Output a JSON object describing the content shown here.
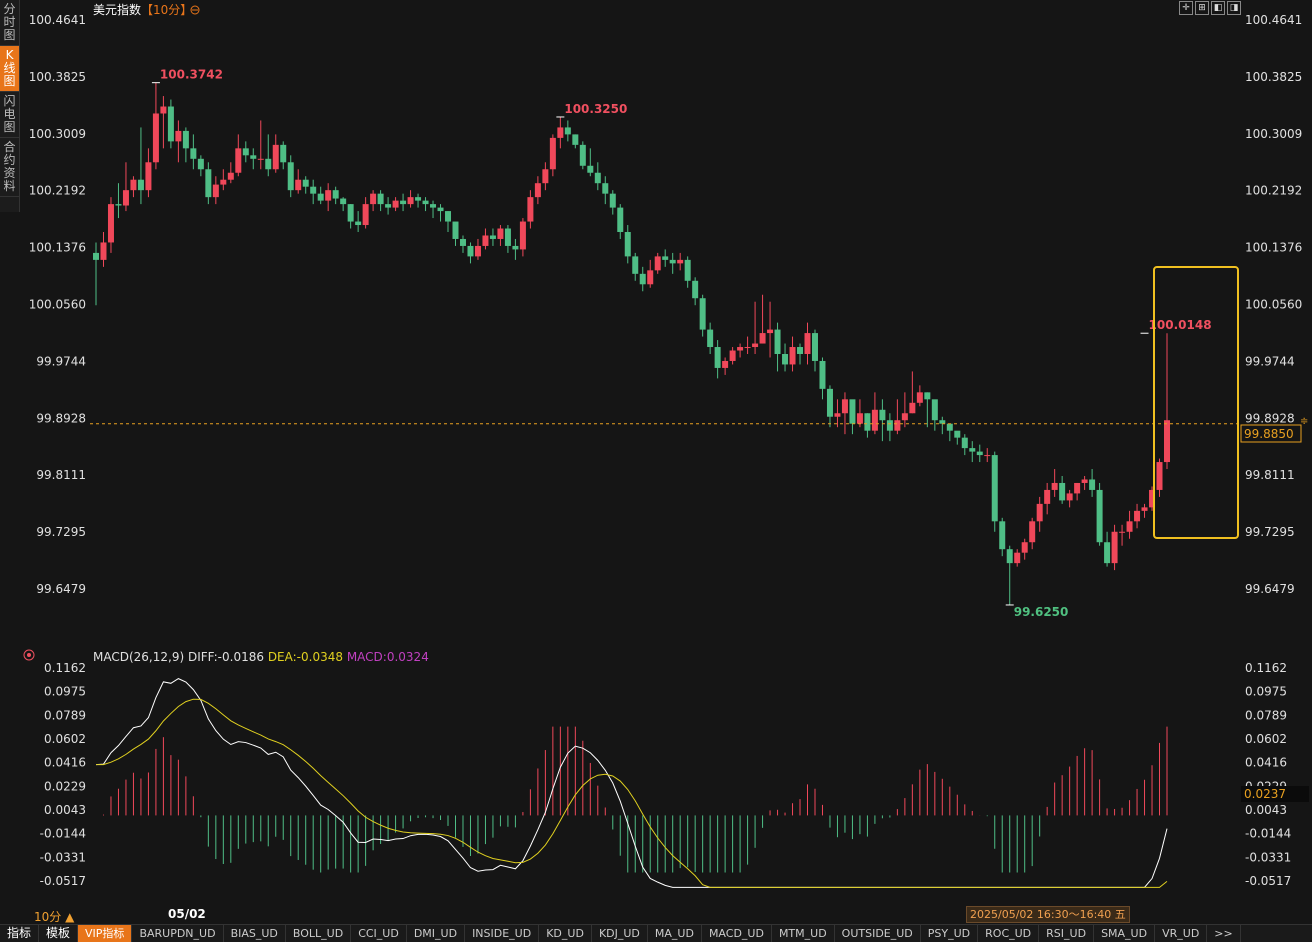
{
  "side_tabs": [
    {
      "label": "分时图",
      "active": false
    },
    {
      "label": "K线图",
      "active": true
    },
    {
      "label": "闪电图",
      "active": false
    },
    {
      "label": "合约资料",
      "active": false
    }
  ],
  "header": {
    "title": "美元指数",
    "period": "【10分】",
    "period_icon": "settings-circle-icon"
  },
  "top_icons": [
    "crosshair-icon",
    "maximize-icon",
    "left-icon",
    "right-icon"
  ],
  "price_axis": {
    "labels": [
      "100.4641",
      "100.3825",
      "100.3009",
      "100.2192",
      "100.1376",
      "100.0560",
      "99.9744",
      "99.8928",
      "99.8111",
      "99.7295",
      "99.6479"
    ],
    "min": 99.6479,
    "max": 100.4641
  },
  "current_price": {
    "value": 99.885,
    "label": "99.8850"
  },
  "annotations": [
    {
      "text": "100.3742",
      "value": 100.3742,
      "candle": 8,
      "color": "#f05060"
    },
    {
      "text": "100.3250",
      "value": 100.325,
      "candle": 62,
      "color": "#f05060"
    },
    {
      "text": "100.0148",
      "value": 100.0148,
      "candle": 140,
      "color": "#f05060"
    },
    {
      "text": "99.6250",
      "value": 99.625,
      "candle": 122,
      "color": "#50c080"
    }
  ],
  "macd": {
    "title": "MACD(26,12,9)",
    "diff": "DIFF:-0.0186",
    "dea": "DEA:-0.0348",
    "macd": "MACD:0.0324",
    "axis_labels": [
      "0.1162",
      "0.0975",
      "0.0789",
      "0.0602",
      "0.0416",
      "0.0229",
      "0.0043",
      "-0.0144",
      "-0.0331",
      "-0.0517"
    ],
    "min": -0.0517,
    "max": 0.1162,
    "current_label": "0.0237"
  },
  "period_label": "10分 ▲",
  "date_label": "05/02",
  "time_range": "2025/05/02 16:30～16:40 五",
  "bottom_tabs": [
    "指标",
    "模板",
    "VIP指标",
    "BARUPDN_UD",
    "BIAS_UD",
    "BOLL_UD",
    "CCI_UD",
    "DMI_UD",
    "INSIDE_UD",
    "KD_UD",
    "KDJ_UD",
    "MA_UD",
    "MACD_UD",
    "MTM_UD",
    "OUTSIDE_UD",
    "PSY_UD",
    "ROC_UD",
    "RSI_UD",
    "SMA_UD",
    "VR_UD",
    ">>"
  ],
  "colors": {
    "up": "#f0485a",
    "down": "#4fbe86",
    "diff": "#ffffff",
    "dea": "#e0d020",
    "highlight": "#f0c020"
  },
  "chart_data": {
    "type": "candlestick",
    "close": [
      100.12,
      100.145,
      100.2,
      100.198,
      100.22,
      100.235,
      100.22,
      100.26,
      100.33,
      100.34,
      100.29,
      100.305,
      100.28,
      100.265,
      100.25,
      100.21,
      100.228,
      100.235,
      100.245,
      100.28,
      100.27,
      100.265,
      100.265,
      100.25,
      100.285,
      100.26,
      100.22,
      100.235,
      100.225,
      100.215,
      100.205,
      100.22,
      100.208,
      100.2,
      100.175,
      100.17,
      100.2,
      100.215,
      100.2,
      100.195,
      100.205,
      100.2,
      100.21,
      100.205,
      100.2,
      100.195,
      100.19,
      100.175,
      100.15,
      100.14,
      100.125,
      100.14,
      100.155,
      100.15,
      100.165,
      100.14,
      100.135,
      100.175,
      100.21,
      100.23,
      100.25,
      100.295,
      100.31,
      100.3,
      100.285,
      100.255,
      100.245,
      100.23,
      100.215,
      100.195,
      100.16,
      100.125,
      100.1,
      100.085,
      100.105,
      100.125,
      100.12,
      100.115,
      100.12,
      100.09,
      100.065,
      100.02,
      99.995,
      99.965,
      99.975,
      99.99,
      99.995,
      99.995,
      100.0,
      100.015,
      100.02,
      99.985,
      99.97,
      99.995,
      99.985,
      100.015,
      99.975,
      99.935,
      99.895,
      99.9,
      99.92,
      99.885,
      99.9,
      99.875,
      99.905,
      99.89,
      99.875,
      99.89,
      99.9,
      99.915,
      99.93,
      99.92,
      99.89,
      99.885,
      99.875,
      99.865,
      99.85,
      99.845,
      99.84,
      99.84,
      99.745,
      99.705,
      99.685,
      99.7,
      99.715,
      99.745,
      99.77,
      99.79,
      99.8,
      99.775,
      99.785,
      99.8,
      99.805,
      99.79,
      99.715,
      99.685,
      99.73,
      99.73,
      99.745,
      99.76,
      99.765,
      99.79,
      99.83,
      99.89
    ],
    "open": [
      100.13,
      100.12,
      100.145,
      100.2,
      100.198,
      100.22,
      100.235,
      100.22,
      100.26,
      100.33,
      100.34,
      100.29,
      100.305,
      100.28,
      100.265,
      100.25,
      100.21,
      100.228,
      100.235,
      100.245,
      100.28,
      100.27,
      100.265,
      100.265,
      100.25,
      100.285,
      100.26,
      100.22,
      100.235,
      100.225,
      100.215,
      100.205,
      100.22,
      100.208,
      100.2,
      100.175,
      100.17,
      100.2,
      100.215,
      100.2,
      100.195,
      100.205,
      100.2,
      100.21,
      100.205,
      100.2,
      100.195,
      100.19,
      100.175,
      100.15,
      100.14,
      100.125,
      100.14,
      100.155,
      100.15,
      100.165,
      100.14,
      100.135,
      100.175,
      100.21,
      100.23,
      100.25,
      100.295,
      100.31,
      100.3,
      100.285,
      100.255,
      100.245,
      100.23,
      100.215,
      100.195,
      100.16,
      100.125,
      100.1,
      100.085,
      100.105,
      100.125,
      100.12,
      100.115,
      100.12,
      100.09,
      100.065,
      100.02,
      99.995,
      99.965,
      99.975,
      99.99,
      99.995,
      99.995,
      100.0,
      100.015,
      100.02,
      99.985,
      99.97,
      99.995,
      99.985,
      100.015,
      99.975,
      99.935,
      99.895,
      99.9,
      99.92,
      99.885,
      99.9,
      99.875,
      99.905,
      99.89,
      99.875,
      99.89,
      99.9,
      99.915,
      99.93,
      99.92,
      99.89,
      99.885,
      99.875,
      99.865,
      99.85,
      99.845,
      99.84,
      99.84,
      99.745,
      99.705,
      99.685,
      99.7,
      99.715,
      99.745,
      99.77,
      99.79,
      99.8,
      99.775,
      99.785,
      99.8,
      99.805,
      99.79,
      99.715,
      99.685,
      99.73,
      99.73,
      99.745,
      99.76,
      99.765,
      99.79,
      99.83
    ],
    "high": [
      100.145,
      100.16,
      100.21,
      100.23,
      100.26,
      100.24,
      100.31,
      100.28,
      100.374,
      100.355,
      100.35,
      100.32,
      100.31,
      100.3,
      100.27,
      100.26,
      100.24,
      100.25,
      100.26,
      100.3,
      100.29,
      100.28,
      100.32,
      100.3,
      100.3,
      100.29,
      100.27,
      100.25,
      100.24,
      100.235,
      100.225,
      100.23,
      100.225,
      100.21,
      100.2,
      100.19,
      100.21,
      100.22,
      100.22,
      100.21,
      100.21,
      100.215,
      100.22,
      100.215,
      100.21,
      100.205,
      100.2,
      100.19,
      100.17,
      100.155,
      100.145,
      100.15,
      100.165,
      100.165,
      100.17,
      100.17,
      100.15,
      100.18,
      100.22,
      100.24,
      100.26,
      100.3,
      100.325,
      100.32,
      100.3,
      100.29,
      100.28,
      100.26,
      100.24,
      100.22,
      100.2,
      100.17,
      100.13,
      100.11,
      100.12,
      100.13,
      100.135,
      100.13,
      100.13,
      100.125,
      100.095,
      100.07,
      100.03,
      100.005,
      99.98,
      99.995,
      100.0,
      100.01,
      100.06,
      100.07,
      100.06,
      100.03,
      100.0,
      100.01,
      100.0,
      100.03,
      100.02,
      99.98,
      99.94,
      99.92,
      99.93,
      99.91,
      99.92,
      99.9,
      99.93,
      99.92,
      99.9,
      99.92,
      99.93,
      99.96,
      99.94,
      99.93,
      99.91,
      99.895,
      99.885,
      99.87,
      99.87,
      99.86,
      99.855,
      99.85,
      99.845,
      99.75,
      99.71,
      99.705,
      99.72,
      99.75,
      99.78,
      99.8,
      99.82,
      99.81,
      99.79,
      99.8,
      99.81,
      99.82,
      99.8,
      99.73,
      99.74,
      99.74,
      99.76,
      99.77,
      99.77,
      99.795,
      99.835,
      100.0148,
      99.895
    ],
    "low": [
      100.055,
      100.11,
      100.13,
      100.18,
      100.19,
      100.21,
      100.2,
      100.21,
      100.25,
      100.28,
      100.28,
      100.26,
      100.26,
      100.25,
      100.24,
      100.2,
      100.2,
      100.22,
      100.23,
      100.24,
      100.26,
      100.25,
      100.25,
      100.24,
      100.245,
      100.25,
      100.21,
      100.215,
      100.215,
      100.2,
      100.2,
      100.19,
      100.2,
      100.19,
      100.165,
      100.16,
      100.165,
      100.19,
      100.19,
      100.185,
      100.19,
      100.19,
      100.195,
      100.195,
      100.19,
      100.18,
      100.175,
      100.16,
      100.14,
      100.13,
      100.115,
      100.12,
      100.135,
      100.14,
      100.14,
      100.13,
      100.12,
      100.125,
      100.165,
      100.2,
      100.22,
      100.24,
      100.28,
      100.29,
      100.28,
      100.25,
      100.24,
      100.22,
      100.2,
      100.185,
      100.15,
      100.115,
      100.09,
      100.075,
      100.08,
      100.1,
      100.11,
      100.1,
      100.105,
      100.08,
      100.055,
      100.01,
      99.985,
      99.95,
      99.955,
      99.97,
      99.98,
      99.985,
      99.985,
      100.0,
      99.98,
      99.96,
      99.96,
      99.96,
      99.97,
      99.97,
      99.96,
      99.92,
      99.88,
      99.88,
      99.87,
      99.87,
      99.88,
      99.865,
      99.87,
      99.86,
      99.86,
      99.87,
      99.88,
      99.9,
      99.91,
      99.88,
      99.875,
      99.87,
      99.86,
      99.855,
      99.84,
      99.83,
      99.83,
      99.83,
      99.73,
      99.695,
      99.625,
      99.68,
      99.69,
      99.705,
      99.73,
      99.755,
      99.78,
      99.77,
      99.765,
      99.775,
      99.79,
      99.78,
      99.71,
      99.68,
      99.675,
      99.71,
      99.72,
      99.735,
      99.75,
      99.76,
      99.78,
      99.82,
      99.75
    ]
  }
}
